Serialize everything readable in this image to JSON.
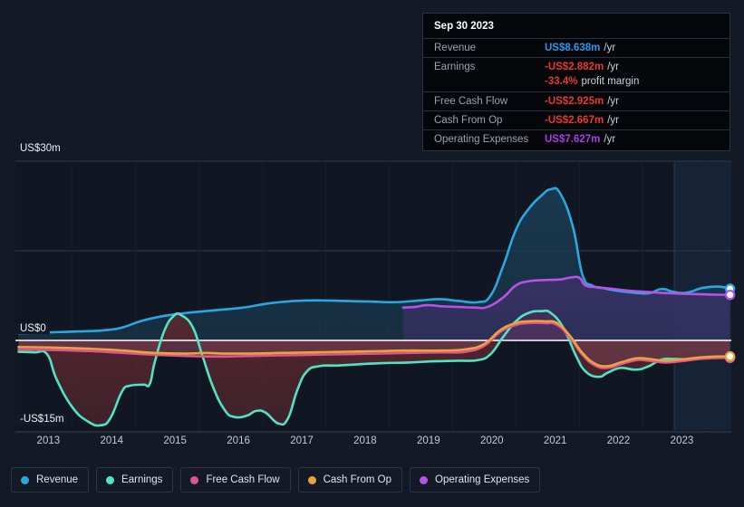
{
  "chart_data": {
    "type": "area",
    "title": "",
    "xlabel": "",
    "ylabel": "",
    "currency_unit": "US$m",
    "grid": true,
    "legend_position": "bottom",
    "ylim": [
      -15,
      30
    ],
    "y_ticks": [
      {
        "label": "US$30m",
        "value": 30
      },
      {
        "label": "US$0",
        "value": 0
      },
      {
        "label": "-US$15m",
        "value": -15
      }
    ],
    "x_ticks": [
      "2013",
      "2014",
      "2015",
      "2016",
      "2017",
      "2018",
      "2019",
      "2020",
      "2021",
      "2022",
      "2023"
    ],
    "x_range": [
      2012.6,
      2023.9
    ],
    "forecast_band": {
      "start": "2023.0",
      "end": "2023.9",
      "label": ""
    },
    "series": [
      {
        "name": "Revenue",
        "color": "#29a8e0",
        "fill": "#1a3b52",
        "points": [
          [
            2012.65,
            1.2
          ],
          [
            2013.0,
            1.3
          ],
          [
            2013.3,
            1.4
          ],
          [
            2013.6,
            1.5
          ],
          [
            2014.0,
            1.7
          ],
          [
            2014.3,
            2.2
          ],
          [
            2014.6,
            3.3
          ],
          [
            2015.0,
            4.2
          ],
          [
            2015.4,
            4.7
          ],
          [
            2015.8,
            5.1
          ],
          [
            2016.2,
            5.5
          ],
          [
            2016.6,
            6.2
          ],
          [
            2017.0,
            6.6
          ],
          [
            2017.4,
            6.7
          ],
          [
            2017.8,
            6.6
          ],
          [
            2018.2,
            6.5
          ],
          [
            2018.6,
            6.4
          ],
          [
            2019.0,
            6.7
          ],
          [
            2019.3,
            6.9
          ],
          [
            2019.6,
            6.6
          ],
          [
            2019.9,
            6.4
          ],
          [
            2020.1,
            7.5
          ],
          [
            2020.3,
            12.5
          ],
          [
            2020.5,
            18.5
          ],
          [
            2020.7,
            22.0
          ],
          [
            2020.9,
            24.2
          ],
          [
            2021.05,
            25.3
          ],
          [
            2021.2,
            24.6
          ],
          [
            2021.4,
            19.0
          ],
          [
            2021.55,
            11.0
          ],
          [
            2021.7,
            9.2
          ],
          [
            2021.9,
            8.7
          ],
          [
            2022.1,
            8.3
          ],
          [
            2022.35,
            8.0
          ],
          [
            2022.6,
            7.9
          ],
          [
            2022.8,
            8.6
          ],
          [
            2023.0,
            8.1
          ],
          [
            2023.2,
            8.0
          ],
          [
            2023.45,
            8.8
          ],
          [
            2023.7,
            9.0
          ],
          [
            2023.88,
            8.638
          ]
        ],
        "last_value": 8.638
      },
      {
        "name": "Earnings",
        "color": "#52e3c2",
        "fill": "#5a2730",
        "points": [
          [
            2012.65,
            -1.9
          ],
          [
            2012.9,
            -2.0
          ],
          [
            2013.1,
            -2.3
          ],
          [
            2013.25,
            -6.5
          ],
          [
            2013.5,
            -11.2
          ],
          [
            2013.75,
            -13.6
          ],
          [
            2013.95,
            -14.2
          ],
          [
            2014.1,
            -13.0
          ],
          [
            2014.28,
            -8.6
          ],
          [
            2014.4,
            -7.6
          ],
          [
            2014.62,
            -7.4
          ],
          [
            2014.72,
            -7.3
          ],
          [
            2014.8,
            -3.6
          ],
          [
            2014.95,
            1.6
          ],
          [
            2015.1,
            4.1
          ],
          [
            2015.22,
            4.2
          ],
          [
            2015.4,
            2.2
          ],
          [
            2015.55,
            -2.5
          ],
          [
            2015.72,
            -7.8
          ],
          [
            2015.9,
            -11.6
          ],
          [
            2016.05,
            -12.8
          ],
          [
            2016.25,
            -12.6
          ],
          [
            2016.4,
            -11.8
          ],
          [
            2016.55,
            -12.1
          ],
          [
            2016.75,
            -13.9
          ],
          [
            2016.9,
            -13.1
          ],
          [
            2017.05,
            -8.3
          ],
          [
            2017.2,
            -5.2
          ],
          [
            2017.4,
            -4.3
          ],
          [
            2017.7,
            -4.2
          ],
          [
            2018.0,
            -4.0
          ],
          [
            2018.4,
            -3.8
          ],
          [
            2018.8,
            -3.7
          ],
          [
            2019.2,
            -3.5
          ],
          [
            2019.6,
            -3.4
          ],
          [
            2019.9,
            -3.3
          ],
          [
            2020.1,
            -2.3
          ],
          [
            2020.3,
            0.6
          ],
          [
            2020.5,
            3.2
          ],
          [
            2020.7,
            4.6
          ],
          [
            2020.9,
            4.9
          ],
          [
            2021.05,
            4.6
          ],
          [
            2021.25,
            2.1
          ],
          [
            2021.45,
            -2.6
          ],
          [
            2021.6,
            -5.2
          ],
          [
            2021.8,
            -6.1
          ],
          [
            2021.95,
            -5.4
          ],
          [
            2022.15,
            -4.6
          ],
          [
            2022.4,
            -4.9
          ],
          [
            2022.6,
            -4.3
          ],
          [
            2022.8,
            -3.2
          ],
          [
            2023.0,
            -3.1
          ],
          [
            2023.25,
            -3.2
          ],
          [
            2023.5,
            -2.9
          ],
          [
            2023.7,
            -2.85
          ],
          [
            2023.88,
            -2.882
          ]
        ],
        "last_value": -2.882
      },
      {
        "name": "Free Cash Flow",
        "color": "#e0548d",
        "fill": "#6b3a4a",
        "points": [
          [
            2012.65,
            -1.5
          ],
          [
            2013.2,
            -1.6
          ],
          [
            2013.8,
            -1.8
          ],
          [
            2014.3,
            -2.1
          ],
          [
            2014.8,
            -2.4
          ],
          [
            2015.3,
            -2.6
          ],
          [
            2015.8,
            -2.7
          ],
          [
            2016.3,
            -2.6
          ],
          [
            2016.8,
            -2.5
          ],
          [
            2017.3,
            -2.4
          ],
          [
            2017.8,
            -2.3
          ],
          [
            2018.3,
            -2.2
          ],
          [
            2018.8,
            -2.1
          ],
          [
            2019.3,
            -2.0
          ],
          [
            2019.7,
            -1.9
          ],
          [
            2020.0,
            -0.9
          ],
          [
            2020.25,
            1.4
          ],
          [
            2020.5,
            2.6
          ],
          [
            2020.7,
            2.9
          ],
          [
            2020.95,
            2.9
          ],
          [
            2021.15,
            2.6
          ],
          [
            2021.35,
            0.5
          ],
          [
            2021.55,
            -2.4
          ],
          [
            2021.75,
            -4.2
          ],
          [
            2021.95,
            -4.6
          ],
          [
            2022.15,
            -4.0
          ],
          [
            2022.4,
            -3.3
          ],
          [
            2022.6,
            -3.4
          ],
          [
            2022.85,
            -3.7
          ],
          [
            2023.1,
            -3.5
          ],
          [
            2023.4,
            -3.1
          ],
          [
            2023.65,
            -2.95
          ],
          [
            2023.88,
            -2.925
          ]
        ],
        "last_value": -2.925
      },
      {
        "name": "Cash From Op",
        "color": "#e8a33d",
        "fill": "none",
        "points": [
          [
            2012.65,
            -1.1
          ],
          [
            2013.2,
            -1.2
          ],
          [
            2013.8,
            -1.4
          ],
          [
            2014.3,
            -1.7
          ],
          [
            2014.8,
            -2.1
          ],
          [
            2015.3,
            -2.2
          ],
          [
            2015.6,
            -2.1
          ],
          [
            2015.9,
            -2.2
          ],
          [
            2016.3,
            -2.2
          ],
          [
            2016.8,
            -2.1
          ],
          [
            2017.3,
            -2.0
          ],
          [
            2017.8,
            -1.9
          ],
          [
            2018.3,
            -1.8
          ],
          [
            2018.8,
            -1.7
          ],
          [
            2019.3,
            -1.7
          ],
          [
            2019.7,
            -1.5
          ],
          [
            2020.0,
            -0.6
          ],
          [
            2020.25,
            1.7
          ],
          [
            2020.5,
            2.9
          ],
          [
            2020.7,
            3.2
          ],
          [
            2020.95,
            3.2
          ],
          [
            2021.15,
            2.9
          ],
          [
            2021.35,
            0.8
          ],
          [
            2021.55,
            -2.1
          ],
          [
            2021.75,
            -3.9
          ],
          [
            2021.95,
            -4.3
          ],
          [
            2022.15,
            -3.7
          ],
          [
            2022.4,
            -3.0
          ],
          [
            2022.6,
            -3.1
          ],
          [
            2022.85,
            -3.4
          ],
          [
            2023.1,
            -3.2
          ],
          [
            2023.4,
            -2.85
          ],
          [
            2023.65,
            -2.7
          ],
          [
            2023.88,
            -2.667
          ]
        ],
        "last_value": -2.667
      },
      {
        "name": "Operating Expenses",
        "color": "#b552e8",
        "fill": "#3a3166",
        "points": [
          [
            2018.72,
            5.5
          ],
          [
            2018.9,
            5.6
          ],
          [
            2019.1,
            5.9
          ],
          [
            2019.35,
            5.7
          ],
          [
            2019.6,
            5.6
          ],
          [
            2019.85,
            5.5
          ],
          [
            2020.05,
            5.6
          ],
          [
            2020.3,
            7.2
          ],
          [
            2020.5,
            9.2
          ],
          [
            2020.7,
            9.9
          ],
          [
            2020.95,
            10.1
          ],
          [
            2021.2,
            10.2
          ],
          [
            2021.35,
            10.5
          ],
          [
            2021.5,
            10.5
          ],
          [
            2021.6,
            9.2
          ],
          [
            2021.8,
            8.9
          ],
          [
            2022.05,
            8.6
          ],
          [
            2022.3,
            8.3
          ],
          [
            2022.6,
            8.1
          ],
          [
            2022.9,
            7.9
          ],
          [
            2023.2,
            7.8
          ],
          [
            2023.5,
            7.7
          ],
          [
            2023.7,
            7.65
          ],
          [
            2023.88,
            7.627
          ]
        ],
        "last_value": 7.627
      }
    ]
  },
  "tooltip": {
    "date": "Sep 30 2023",
    "rows": [
      {
        "label": "Revenue",
        "value": "US$8.638m",
        "unit": "/yr",
        "color": "#2f95e8",
        "separator": true
      },
      {
        "label": "Earnings",
        "value": "-US$2.882m",
        "unit": "/yr",
        "color": "#e8392f",
        "separator": true
      },
      {
        "label": "",
        "value": "-33.4%",
        "sub": "profit margin",
        "color": "#e8392f",
        "separator": false
      },
      {
        "label": "Free Cash Flow",
        "value": "-US$2.925m",
        "unit": "/yr",
        "color": "#e8392f",
        "separator": true
      },
      {
        "label": "Cash From Op",
        "value": "-US$2.667m",
        "unit": "/yr",
        "color": "#e8392f",
        "separator": true
      },
      {
        "label": "Operating Expenses",
        "value": "US$7.627m",
        "unit": "/yr",
        "color": "#a93ce8",
        "separator": true
      }
    ]
  },
  "legend": {
    "items": [
      {
        "label": "Revenue",
        "color": "#29a8e0"
      },
      {
        "label": "Earnings",
        "color": "#52e3c2"
      },
      {
        "label": "Free Cash Flow",
        "color": "#e0548d"
      },
      {
        "label": "Cash From Op",
        "color": "#e8a33d"
      },
      {
        "label": "Operating Expenses",
        "color": "#b552e8"
      }
    ]
  }
}
